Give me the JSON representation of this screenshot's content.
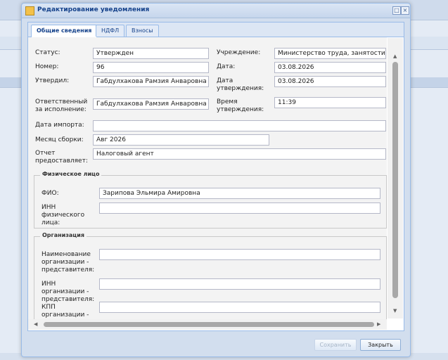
{
  "window": {
    "title": "Редактирование уведомления"
  },
  "tabs": [
    "Общие сведения",
    "НДФЛ",
    "Взносы"
  ],
  "form": {
    "status_label": "Статус:",
    "status_value": "Утвержден",
    "number_label": "Номер:",
    "number_value": "96",
    "approved_by_label": "Утвердил:",
    "approved_by_value": "Габдулхакова Рамзия Анваровна",
    "responsible_label": "Ответственный за исполнение:",
    "responsible_value": "Габдулхакова Рамзия Анваровна",
    "institution_label": "Учреждение:",
    "institution_value": "Министерство труда, занятости и с",
    "date_label": "Дата:",
    "date_value": "03.08.2026",
    "approval_date_label": "Дата утверждения:",
    "approval_date_value": "03.08.2026",
    "approval_time_label": "Время утверждения:",
    "approval_time_value": "11:39",
    "import_date_label": "Дата импорта:",
    "import_date_value": "",
    "month_label": "Месяц сборки:",
    "month_value": "Авг 2026",
    "report_label": "Отчет предоставляет:",
    "report_value": "Налоговый агент"
  },
  "person": {
    "legend": "Физическое лицо",
    "fio_label": "ФИО:",
    "fio_value": "Зарипова Эльмира Амировна",
    "inn_label": "ИНН физического лица:",
    "inn_value": ""
  },
  "org": {
    "legend": "Организация",
    "name_label": "Наименование организации - представителя:",
    "name_value": "",
    "inn_label": "ИНН организации - представителя:",
    "inn_value": "",
    "kpp_label": "КПП организации - представителя:",
    "kpp_value": ""
  },
  "buttons": {
    "save": "Сохранить",
    "close": "Закрыть"
  },
  "icons": {
    "app": "notification-icon",
    "maximize": "maximize-icon",
    "close": "close-icon"
  }
}
